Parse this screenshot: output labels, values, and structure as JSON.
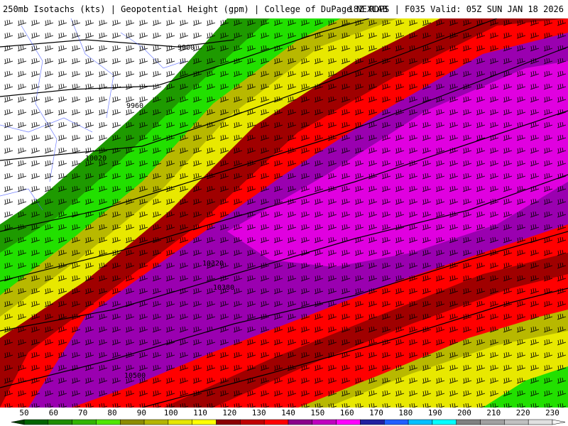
{
  "header": {
    "title_left": "250mb Isotachs (kts) | Geopotential Height (gpm) | College of DuPage NEXLAB",
    "title_right": "18Z RDPS | F035 Valid: 05Z SUN JAN 18 2026"
  },
  "contour_labels": [
    "9900",
    "9960",
    "10020",
    "10320",
    "10380",
    "10500"
  ],
  "colorbar": {
    "ticks": [
      "50",
      "60",
      "70",
      "80",
      "90",
      "100",
      "110",
      "120",
      "130",
      "140",
      "150",
      "160",
      "170",
      "180",
      "190",
      "200",
      "210",
      "220",
      "230"
    ],
    "colors": [
      "#006400",
      "#1e8c00",
      "#32b400",
      "#50e600",
      "#8c8c00",
      "#b4b400",
      "#e6e600",
      "#ffff00",
      "#8b0000",
      "#c00000",
      "#ff0000",
      "#8b008b",
      "#c000c0",
      "#ff00ff",
      "#2020a0",
      "#2060ff",
      "#00c0ff",
      "#00ffff",
      "#808080",
      "#a0a0a0",
      "#c0c0c0",
      "#e0e0e0"
    ]
  },
  "bands": {
    "white": "#ffffff",
    "green": "#22a000",
    "bright_green": "#22e000",
    "olive": "#b5b500",
    "yellow": "#e8e800",
    "dark_red": "#a00000",
    "red": "#ff0000",
    "purple": "#9000a8",
    "magenta": "#e000e0"
  }
}
